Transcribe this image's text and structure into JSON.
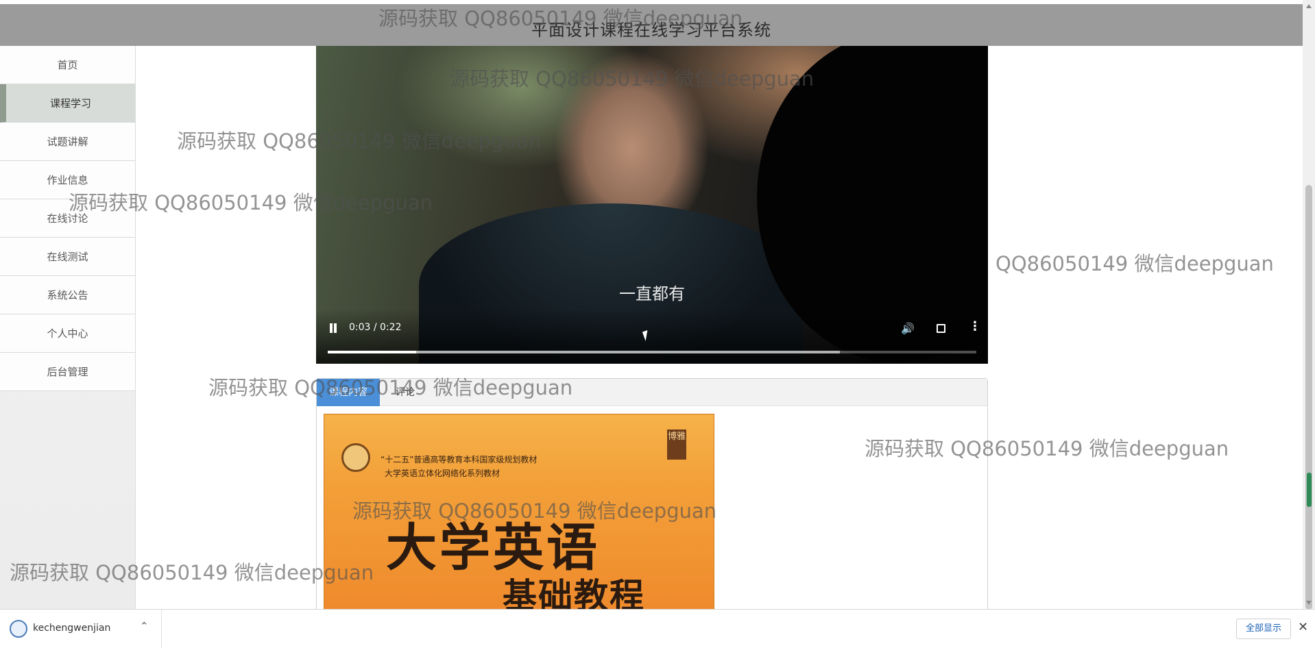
{
  "header": {
    "title": "平面设计课程在线学习平台系统"
  },
  "sidebar": {
    "items": [
      {
        "label": "首页"
      },
      {
        "label": "课程学习"
      },
      {
        "label": "试题讲解"
      },
      {
        "label": "作业信息"
      },
      {
        "label": "在线讨论"
      },
      {
        "label": "在线测试"
      },
      {
        "label": "系统公告"
      },
      {
        "label": "个人中心"
      },
      {
        "label": "后台管理"
      }
    ],
    "active_index": 1
  },
  "video": {
    "subtitle": "一直都有",
    "time": "0:03 / 0:22",
    "progress": 0.136,
    "buffered": 0.79,
    "icons": [
      "pause-icon",
      "volume-icon",
      "fullscreen-icon",
      "more-icon"
    ]
  },
  "tabs": [
    {
      "label": "课程内容",
      "active": true
    },
    {
      "label": "评论",
      "active": false
    }
  ],
  "book": {
    "line1": "“十二五”普通高等教育本科国家级规划教材",
    "line2": "大学英语立体化网络化系列教材",
    "badge": "博雅",
    "title": "大学英语",
    "subtitle": "基础教程"
  },
  "downloads": {
    "file_name": "kechengwenjian",
    "show_all": "全部显示",
    "close": "✕",
    "chevron": "⌃"
  },
  "watermarks": [
    "源码获取 QQ86050149 微信deepguan",
    "源码获取 QQ86050149 微信deepguan",
    "源码获取 QQ86050149 微信deepguan",
    "源码获取 QQ86050149 微信deepguan",
    "QQ86050149 微信deepguan",
    "源码获取 QQ86050149 微信deepguan",
    "源码获取 QQ86050149 微信deepguan",
    "源码获取 QQ86050149 微信deepguan",
    "源码获取 QQ86050149 微信deepguan"
  ]
}
